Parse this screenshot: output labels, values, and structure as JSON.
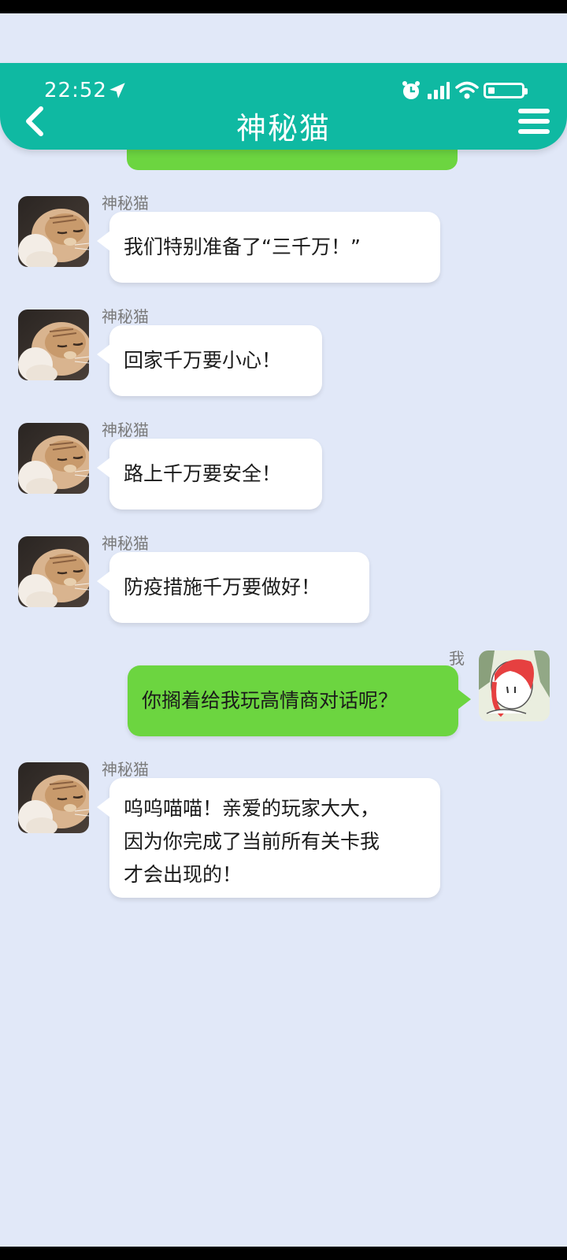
{
  "status_bar": {
    "time": "22:52"
  },
  "header": {
    "title": "神秘猫"
  },
  "messages": [
    {
      "sender": "神秘猫",
      "text": "我们特别准备了“三千万！”"
    },
    {
      "sender": "神秘猫",
      "text": "回家千万要小心！"
    },
    {
      "sender": "神秘猫",
      "text": "路上千万要安全！"
    },
    {
      "sender": "神秘猫",
      "text": "防疫措施千万要做好！"
    },
    {
      "sender": "我",
      "text": "你搁着给我玩高情商对话呢？"
    },
    {
      "sender": "神秘猫",
      "lines": [
        "呜呜喵喵！亲爱的玩家大大，",
        "因为你完成了当前所有关卡我",
        "才会出现的！"
      ]
    }
  ],
  "icons": {
    "back": "chevron-left-icon",
    "menu": "menu-icon",
    "location": "location-arrow-icon",
    "alarm": "alarm-icon",
    "signal": "signal-icon",
    "wifi": "wifi-icon",
    "battery": "battery-icon"
  },
  "colors": {
    "header": "#0fb9a2",
    "background": "#e1e8f8",
    "my_bubble": "#6cd540",
    "other_bubble": "#ffffff"
  }
}
